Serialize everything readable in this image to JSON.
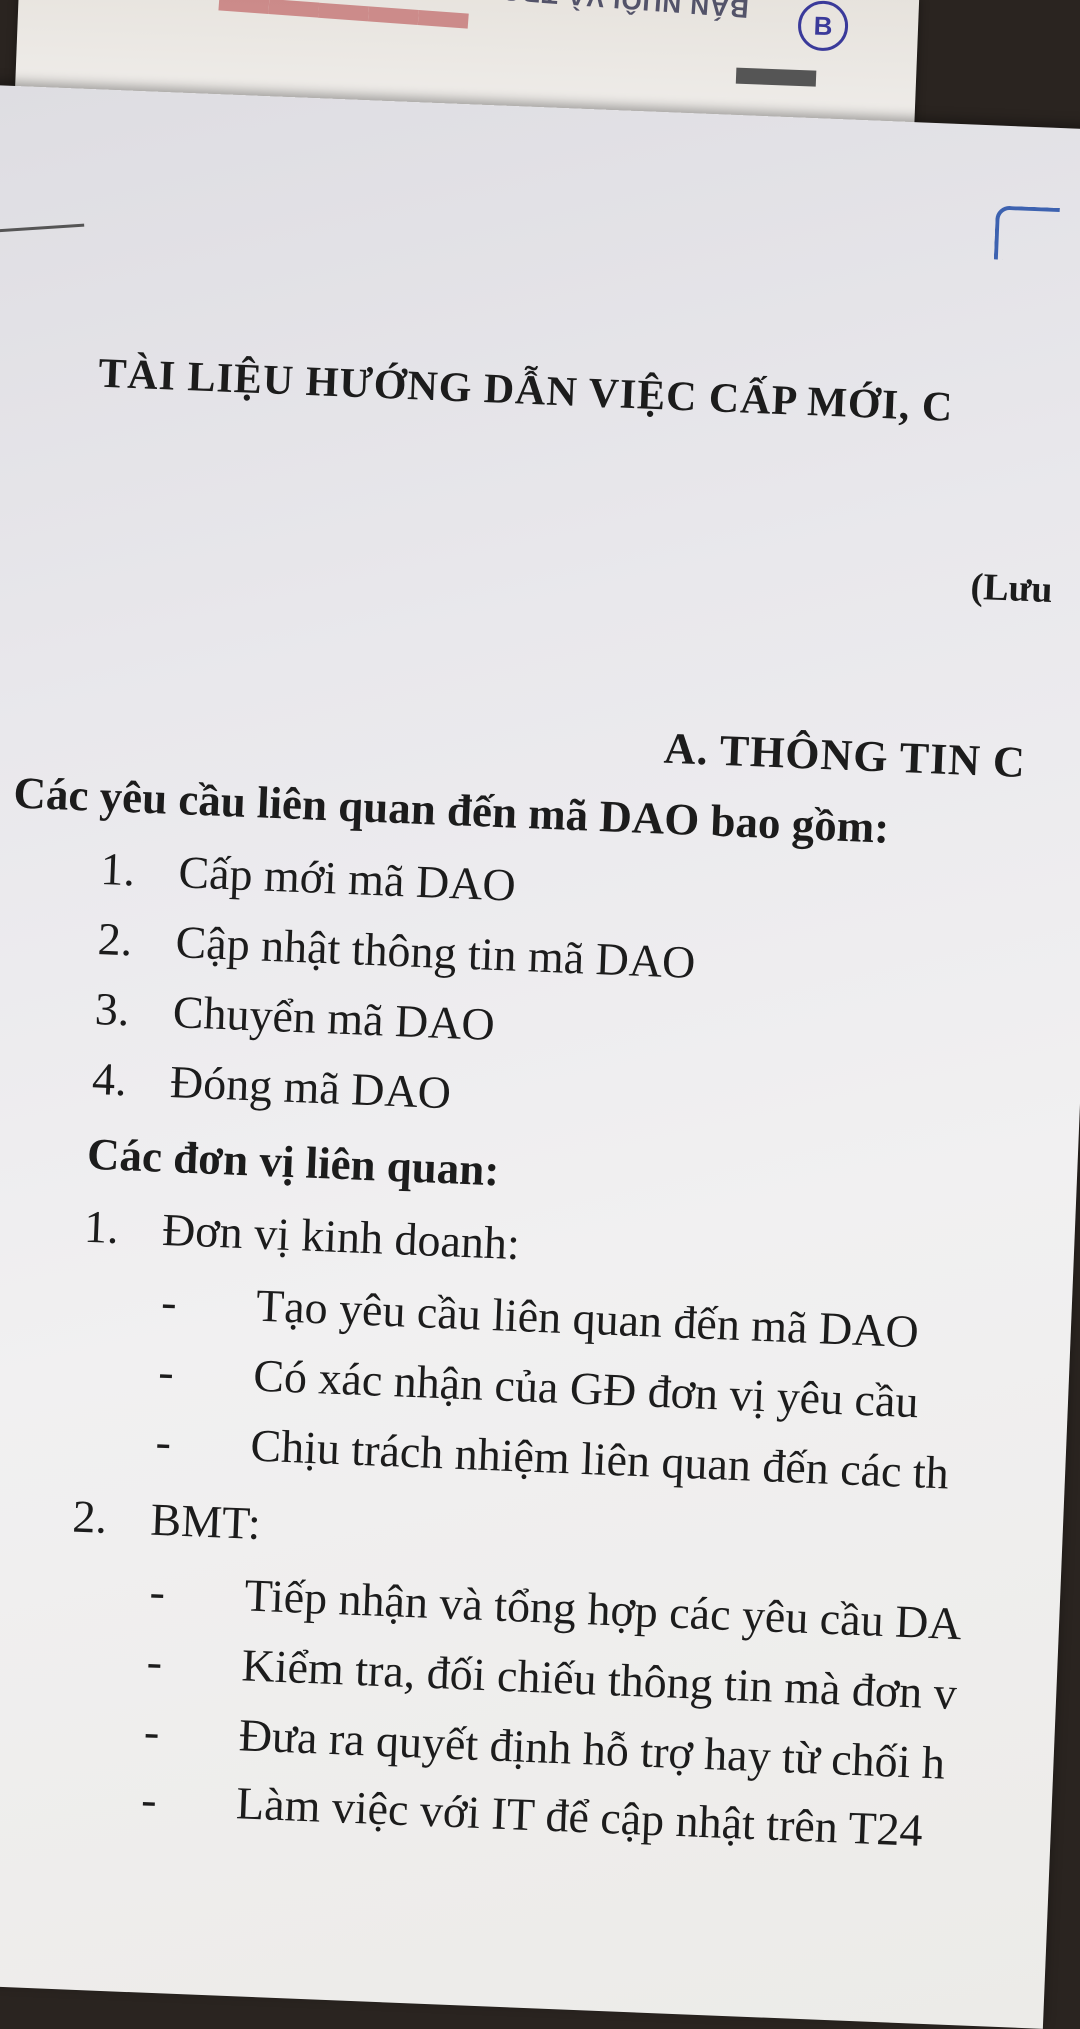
{
  "document": {
    "title": "TÀI LIỆU HƯỚNG DẪN VIỆC CẤP MỚI, C",
    "note": "(Lưu",
    "section_heading": "A.  THÔNG TIN C",
    "requests_heading": "Các yêu cầu liên quan đến mã DAO bao gồm:",
    "requests": [
      {
        "num": "1.",
        "text": "Cấp mới mã DAO"
      },
      {
        "num": "2.",
        "text": "Cập nhật thông tin mã DAO"
      },
      {
        "num": "3.",
        "text": "Chuyển mã DAO"
      },
      {
        "num": "4.",
        "text": "Đóng mã DAO"
      }
    ],
    "units_heading": "Các đơn vị liên quan:",
    "units": [
      {
        "num": "1.",
        "name": "Đơn vị kinh doanh:",
        "tasks": [
          "Tạo yêu cầu liên quan đến mã DAO",
          "Có xác nhận của GĐ đơn vị yêu cầu",
          "Chịu trách nhiệm liên quan đến các th"
        ]
      },
      {
        "num": "2.",
        "name": "BMT:",
        "tasks": [
          "Tiếp nhận và tổng hợp các yêu cầu DA",
          "Kiểm tra, đối chiếu thông tin mà đơn v",
          "Đưa ra quyết định hỗ trợ hay từ chối h",
          "Làm việc với IT để cập nhật trên T24"
        ]
      }
    ],
    "dash": "-"
  },
  "background": {
    "sheet_text": "BÁN NUÔI VÀ TRONG",
    "logo_text": "B"
  }
}
